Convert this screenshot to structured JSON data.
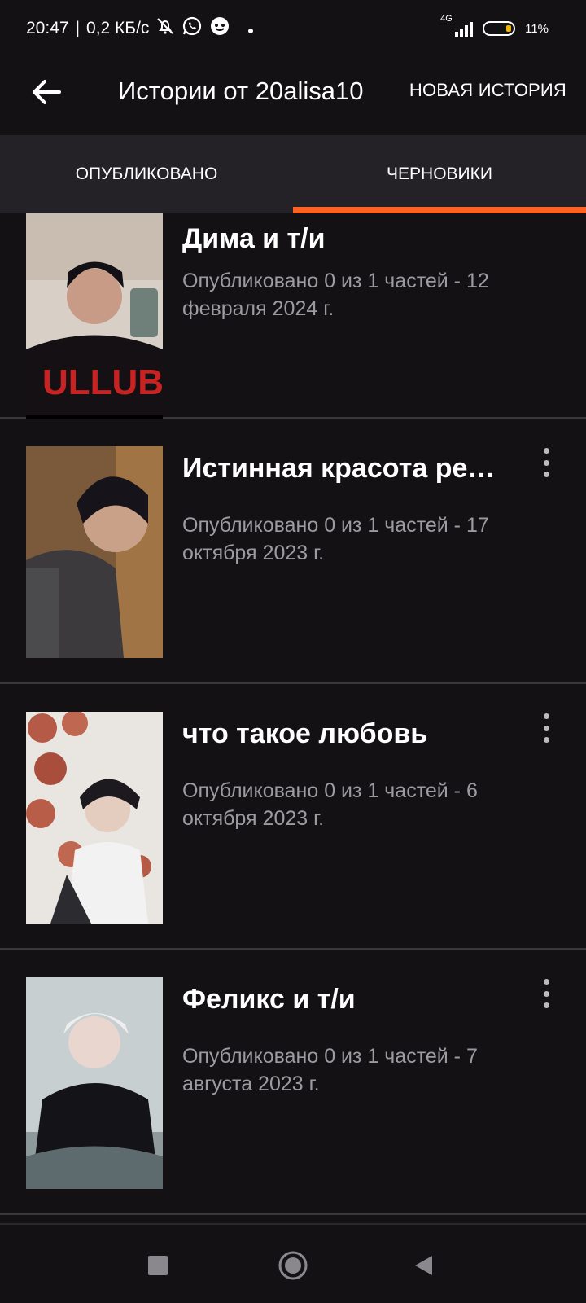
{
  "status_bar": {
    "time": "20:47",
    "speed": "0,2 КБ/с",
    "network": "4G",
    "battery": "11%",
    "icons": [
      "bell-muted-icon",
      "whatsapp-icon",
      "messenger-icon",
      "dot-icon",
      "signal-icon",
      "battery-icon"
    ]
  },
  "app_bar": {
    "title": "Истории от 20alisa10",
    "new_story": "НОВАЯ ИСТОРИЯ",
    "back_icon": "arrow-left-icon"
  },
  "tabs": [
    {
      "label": "ОПУБЛИКОВАНО",
      "active": false
    },
    {
      "label": "ЧЕРНОВИКИ",
      "active": true
    }
  ],
  "accent_color": "#ff6122",
  "stories": [
    {
      "title": "Дима и т/и",
      "meta": "Опубликовано 0 из 1 частей - 12 февраля 2024 г."
    },
    {
      "title": "Истинная красота реальности",
      "meta": "Опубликовано 0 из 1 частей - 17 октября 2023 г."
    },
    {
      "title": "что такое любовь",
      "meta": "Опубликовано 0 из 1 частей - 6 октября 2023 г."
    },
    {
      "title": "Феликс и т/и",
      "meta": "Опубликовано 0 из 1 частей - 7 августа 2023 г."
    }
  ],
  "nav_bar": {
    "icons": [
      "recents-square-icon",
      "home-circle-icon",
      "back-triangle-icon"
    ]
  }
}
